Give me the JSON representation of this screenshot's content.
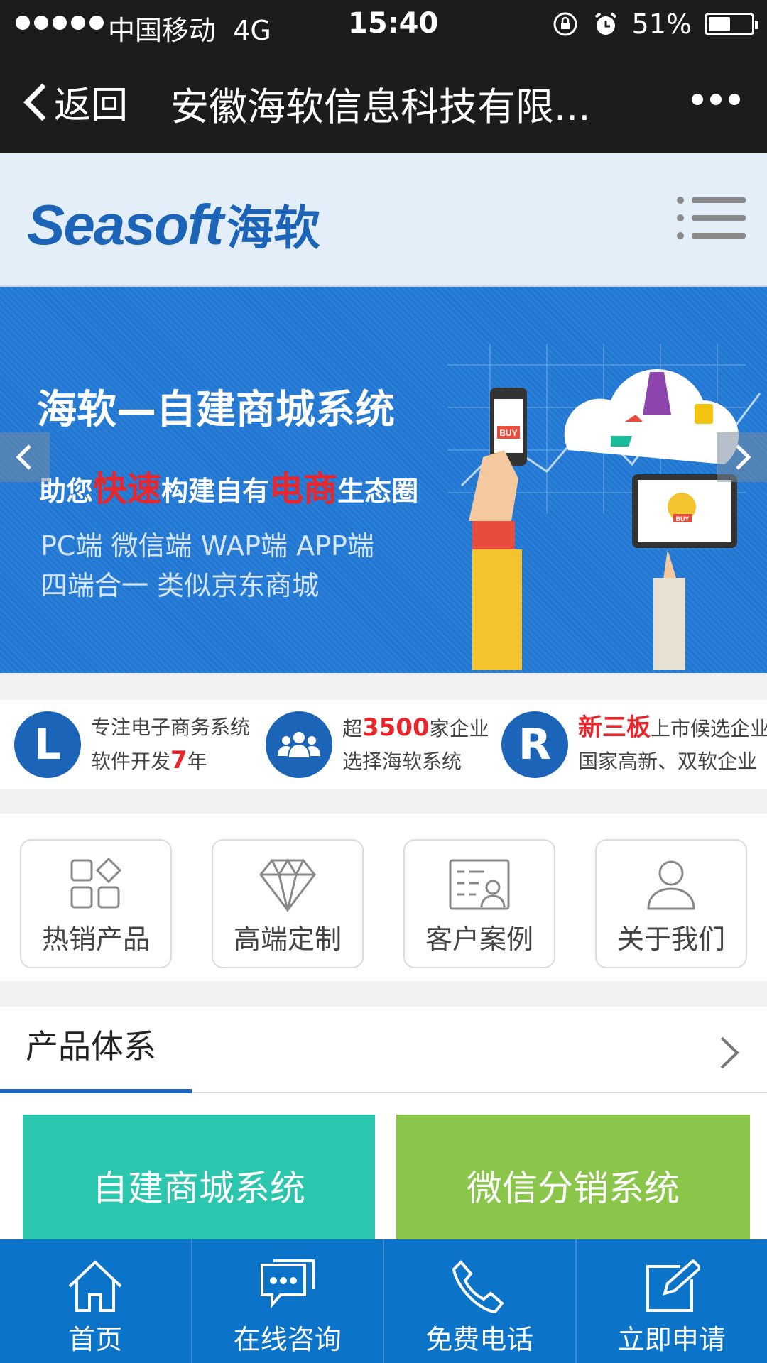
{
  "status_bar": {
    "carrier": "中国移动",
    "network": "4G",
    "time": "15:40",
    "battery": "51%",
    "battery_level": 0.51
  },
  "nav": {
    "back_label": "返回",
    "title": "安徽海软信息科技有限..."
  },
  "site": {
    "logo_text": "Seasoft",
    "logo_cn": "海软"
  },
  "banner": {
    "title": "海软—自建商城系统",
    "slogan": {
      "p1": "助您",
      "h1": "快速",
      "p2": "构建自有",
      "h2": "电商",
      "p3": "生态圈"
    },
    "line1": "PC端  微信端  WAP端  APP端",
    "line2": "四端合一  类似京东商城",
    "buy_label": "BUY"
  },
  "features": [
    {
      "icon_letter": "L",
      "l1": "专注电子商务系统",
      "l2a": "软件开发",
      "l2h": "7",
      "l2b": "年"
    },
    {
      "icon_letter": "",
      "l1a": "超",
      "l1h": "3500",
      "l1b": "家企业",
      "l2": "选择海软系统"
    },
    {
      "icon_letter": "R",
      "l1h": "新三板",
      "l1b": "上市候选企业",
      "l2": "国家高新、双软企业"
    }
  ],
  "categories": [
    {
      "label": "热销产品",
      "icon": "grid-icon"
    },
    {
      "label": "高端定制",
      "icon": "diamond-icon"
    },
    {
      "label": "客户案例",
      "icon": "id-card-icon"
    },
    {
      "label": "关于我们",
      "icon": "person-icon"
    }
  ],
  "section": {
    "title": "产品体系"
  },
  "products": [
    {
      "label": "自建商城系统",
      "color": "#2ac6ad"
    },
    {
      "label": "微信分销系统",
      "color": "#8ac64a"
    }
  ],
  "tabbar": [
    {
      "label": "首页",
      "icon": "home-icon"
    },
    {
      "label": "在线咨询",
      "icon": "chat-icon"
    },
    {
      "label": "免费电话",
      "icon": "phone-icon"
    },
    {
      "label": "立即申请",
      "icon": "edit-icon"
    }
  ],
  "colors": {
    "brand": "#1c64b8",
    "tabbar": "#0b73c8",
    "highlight": "#e8262b"
  }
}
